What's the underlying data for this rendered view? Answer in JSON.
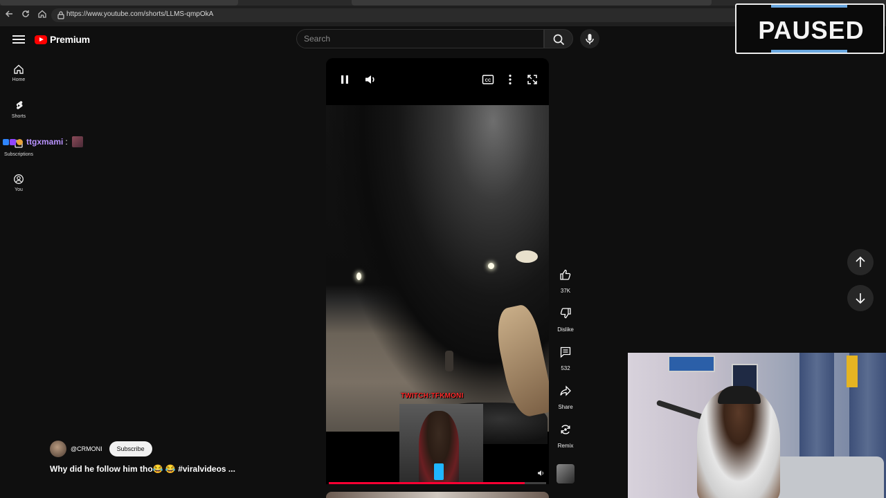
{
  "browser": {
    "url": "https://www.youtube.com/shorts/LLMS-qmpOkA"
  },
  "header": {
    "logo_text": "Premium",
    "search_placeholder": "Search"
  },
  "sidebar": {
    "items": [
      {
        "label": "Home",
        "icon": "home-icon"
      },
      {
        "label": "Shorts",
        "icon": "shorts-icon"
      },
      {
        "label": "Subscriptions",
        "icon": "subscriptions-icon"
      },
      {
        "label": "You",
        "icon": "you-icon"
      }
    ]
  },
  "chat": {
    "username": "ttgxmami",
    "separator": ":"
  },
  "video": {
    "overlay_text": "TWITCH:TFKMONI",
    "progress": 0.9
  },
  "actions": {
    "like_count": "37K",
    "dislike_label": "Dislike",
    "comment_count": "532",
    "share_label": "Share",
    "remix_label": "Remix"
  },
  "channel": {
    "handle": "@CRMONI",
    "subscribe_label": "Subscribe"
  },
  "short_title": "Why did he follow him tho😂 😂 #viralvideos ...",
  "overlay": {
    "paused_text": "PAUSED"
  },
  "colors": {
    "accent": "#ff0000",
    "progress": "#ff0033",
    "chat_name": "#b993ff",
    "twitch_label": "#ff2b2b"
  }
}
